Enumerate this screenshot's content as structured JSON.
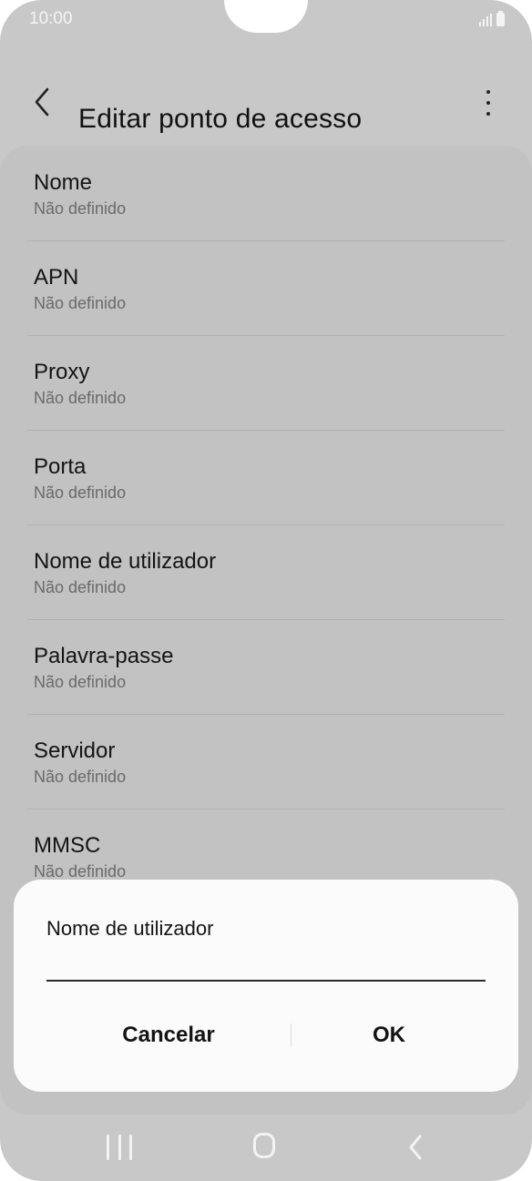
{
  "status_bar": {
    "time": "10:00",
    "icons": [
      "signal-icon",
      "battery-icon"
    ]
  },
  "header": {
    "title": "Editar ponto de acesso",
    "back_icon": "chevron-left-icon",
    "menu_icon": "more-vertical-icon"
  },
  "settings": {
    "items": [
      {
        "title": "Nome",
        "value": "Não definido"
      },
      {
        "title": "APN",
        "value": "Não definido"
      },
      {
        "title": "Proxy",
        "value": "Não definido"
      },
      {
        "title": "Porta",
        "value": "Não definido"
      },
      {
        "title": "Nome de utilizador",
        "value": "Não definido"
      },
      {
        "title": "Palavra-passe",
        "value": "Não definido"
      },
      {
        "title": "Servidor",
        "value": "Não definido"
      },
      {
        "title": "MMSC",
        "value": "Não definido"
      }
    ]
  },
  "dialog": {
    "title": "Nome de utilizador",
    "input_value": "",
    "cancel_label": "Cancelar",
    "ok_label": "OK"
  },
  "nav_bar": {
    "icons": [
      "recents-icon",
      "home-icon",
      "back-icon"
    ]
  },
  "colors": {
    "background_dim": "#c8c8c8",
    "dialog": "#fbfbfb",
    "text_primary": "#141414",
    "text_secondary": "#6a6a6a"
  }
}
